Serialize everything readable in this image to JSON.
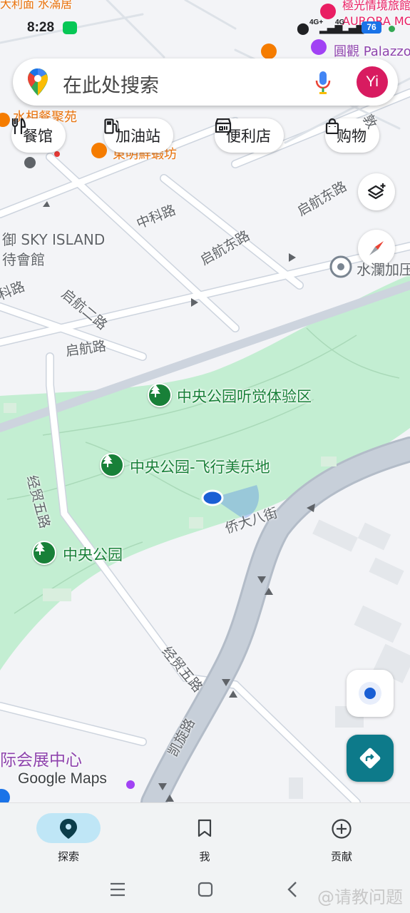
{
  "status_bar": {
    "time": "8:28",
    "network1": "4G+",
    "network2": "4G",
    "battery": "76"
  },
  "search": {
    "placeholder": "在此处搜索",
    "avatar_initials": "Yi"
  },
  "chips": [
    {
      "label": "餐馆",
      "icon": "restaurant-icon"
    },
    {
      "label": "加油站",
      "icon": "gas-station-icon"
    },
    {
      "label": "便利店",
      "icon": "convenience-store-icon"
    },
    {
      "label": "购物",
      "icon": "shopping-bag-icon"
    }
  ],
  "map": {
    "top_labels": {
      "top_left": "大利面 水滿居",
      "top_right_hotel": "極光情境旅館",
      "top_right_hotel_en": "AURORA MO",
      "palazzo": "圓觀 Palazzo",
      "food_court": "水相餐聚苑",
      "shrimp": "東明鮮蝦坊"
    },
    "place_labels": {
      "sky_island": "御 SKY ISLAND",
      "banquet": "待會館",
      "shuilan": "水瀾加压",
      "expo": "际会展中心"
    },
    "roads": {
      "zhongke": "中科路",
      "zhongke_left": "科路",
      "qihang_dong_1": "启航东路",
      "qihang_dong_2": "启航东路",
      "qihang_er": "启航二路",
      "qihang": "启航路",
      "jingmao_wu_1": "经贸五路",
      "jingmao_wu_2": "经贸五路",
      "qiaoda_ba": "侨大八街",
      "kaixuan": "凯旋路",
      "dunhuang": "敦"
    },
    "pois": [
      {
        "name": "中央公园听觉体验区",
        "icon": "park-icon"
      },
      {
        "name": "中央公园-飞行美乐地",
        "icon": "park-icon"
      },
      {
        "name": "中央公园",
        "icon": "park-icon"
      }
    ],
    "attribution": "Google Maps",
    "colors": {
      "park": "#c3eed2",
      "road": "#ffffff",
      "road_outline": "#c8d0dc",
      "major_road": "#b8c0cc",
      "building": "#e6e8eb",
      "location": "#1a5fd4"
    }
  },
  "bottom_nav": [
    {
      "label": "探索",
      "icon": "explore-pin-icon",
      "active": true
    },
    {
      "label": "我",
      "icon": "bookmark-icon",
      "active": false
    },
    {
      "label": "贡献",
      "icon": "add-circle-icon",
      "active": false
    }
  ],
  "watermark": "@请教问题"
}
